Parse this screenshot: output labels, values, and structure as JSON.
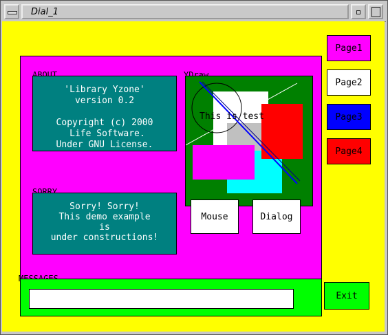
{
  "window": {
    "title": "Dial_1"
  },
  "about": {
    "label": "ABOUT",
    "text": "'Library Yzone'\nversion 0.2\n\nCopyright (c) 2000\n Life Software.\nUnder GNU License."
  },
  "sorry": {
    "label": "SORRY",
    "text": "Sorry! Sorry!\nThis demo example\nis\nunder constructions!"
  },
  "ydraw": {
    "label": "YDraw..",
    "test_text": "This is test"
  },
  "pages": [
    {
      "label": "Page1",
      "color": "#ff00ff"
    },
    {
      "label": "Page2",
      "color": "#ffffff"
    },
    {
      "label": "Page3",
      "color": "#0000ff"
    },
    {
      "label": "Page4",
      "color": "#ff0000"
    }
  ],
  "buttons": {
    "mouse": "Mouse",
    "dialog": "Dialog",
    "exit": "Exit"
  },
  "messages": {
    "label": "MESSAGES",
    "value": ""
  },
  "colors": {
    "client_bg": "#ffff00",
    "panel_bg": "#ff00ff",
    "info_box": "#008080",
    "canvas_bg": "#008000",
    "messages_bg": "#00ff00"
  }
}
